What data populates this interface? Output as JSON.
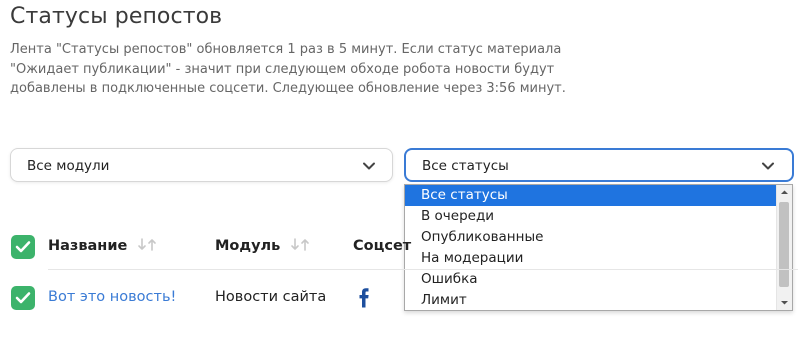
{
  "page": {
    "title": "Статусы репостов",
    "description": "Лента \"Статусы репостов\" обновляется 1 раз в 5 минут. Если статус материала \"Ожидает публикации\" - значит при следующем обходе робота новости будут добавлены в подключенные соцсети. Следующее обновление через 3:56 минут."
  },
  "filters": {
    "module": {
      "value": "Все модули"
    },
    "status": {
      "value": "Все статусы",
      "options": [
        "Все статусы",
        "В очереди",
        "Опубликованные",
        "На модерации",
        "Ошибка",
        "Лимит"
      ],
      "selected_index": 0
    }
  },
  "table": {
    "columns": {
      "name": "Название",
      "module": "Модуль",
      "social": "Соцсет"
    },
    "rows": [
      {
        "name": "Вот это новость!",
        "module": "Новости сайта",
        "social_icon": "facebook-icon"
      }
    ]
  },
  "colors": {
    "accent": "#3a7bd5",
    "checkbox": "#3cb36b",
    "option_selected": "#1f74e0",
    "facebook": "#1d4f9e"
  }
}
